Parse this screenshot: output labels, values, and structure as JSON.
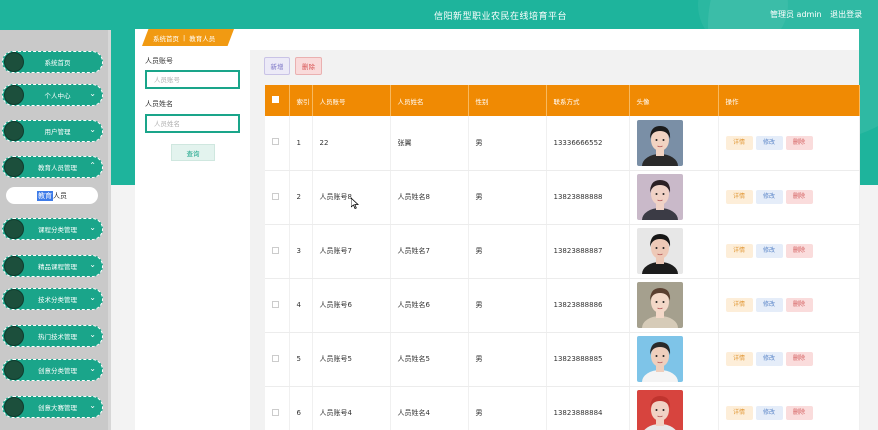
{
  "header": {
    "title": "信阳新型职业农民在线培育平台",
    "user_label": "管理员 admin",
    "logout_label": "退出登录"
  },
  "sidebar": {
    "items": [
      {
        "label": "系统首页"
      },
      {
        "label": "个人中心"
      },
      {
        "label": "用户管理"
      },
      {
        "label": "教育人员管理"
      },
      {
        "label": "课程分类管理"
      },
      {
        "label": "精品课程管理"
      },
      {
        "label": "技术分类管理"
      },
      {
        "label": "热门技术管理"
      },
      {
        "label": "创意分类管理"
      },
      {
        "label": "创意大赛管理"
      }
    ],
    "submenu": {
      "prefix": "教育",
      "rest": "人员"
    }
  },
  "breadcrumb": {
    "home": "系统首页",
    "separator": "|",
    "current": "教育人员"
  },
  "search": {
    "account_label": "人员账号",
    "account_placeholder": "人员账号",
    "name_label": "人员姓名",
    "name_placeholder": "人员姓名",
    "query_button": "查询"
  },
  "toolbar": {
    "add_label": "新增",
    "delete_label": "删除"
  },
  "table": {
    "columns": [
      "索引",
      "人员账号",
      "人员姓名",
      "性别",
      "联系方式",
      "头像",
      "操作"
    ],
    "actions": {
      "detail": "详情",
      "edit": "修改",
      "delete": "删除"
    },
    "rows": [
      {
        "index": "1",
        "account": "22",
        "name": "张翼",
        "gender": "男",
        "phone": "13336666552"
      },
      {
        "index": "2",
        "account": "人员账号8",
        "name": "人员姓名8",
        "gender": "男",
        "phone": "13823888888"
      },
      {
        "index": "3",
        "account": "人员账号7",
        "name": "人员姓名7",
        "gender": "男",
        "phone": "13823888887"
      },
      {
        "index": "4",
        "account": "人员账号6",
        "name": "人员姓名6",
        "gender": "男",
        "phone": "13823888886"
      },
      {
        "index": "5",
        "account": "人员账号5",
        "name": "人员姓名5",
        "gender": "男",
        "phone": "13823888885"
      },
      {
        "index": "6",
        "account": "人员账号4",
        "name": "人员姓名4",
        "gender": "男",
        "phone": "13823888884"
      }
    ]
  },
  "colors": {
    "primary": "#1eb49c",
    "table_header": "#f08a03",
    "breadcrumb": "#f19a12"
  }
}
